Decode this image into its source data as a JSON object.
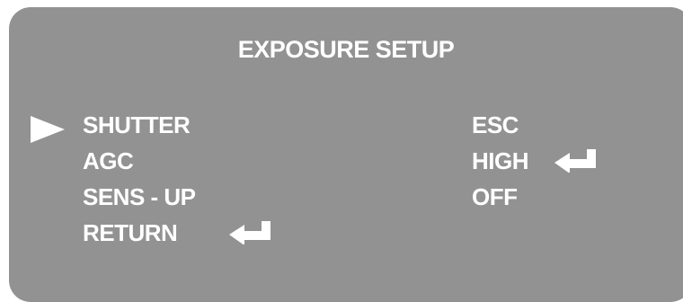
{
  "menu": {
    "title": "EXPOSURE SETUP",
    "items": [
      {
        "label": "SHUTTER",
        "value": "ESC"
      },
      {
        "label": "AGC",
        "value": "HIGH"
      },
      {
        "label": "SENS - UP",
        "value": "OFF"
      },
      {
        "label": "RETURN"
      }
    ],
    "selected_index": 0
  },
  "icons": {
    "cursor": "selection-arrow-icon",
    "submenu": "enter-return-icon"
  },
  "colors": {
    "background": "#929292",
    "text": "#ffffff"
  }
}
